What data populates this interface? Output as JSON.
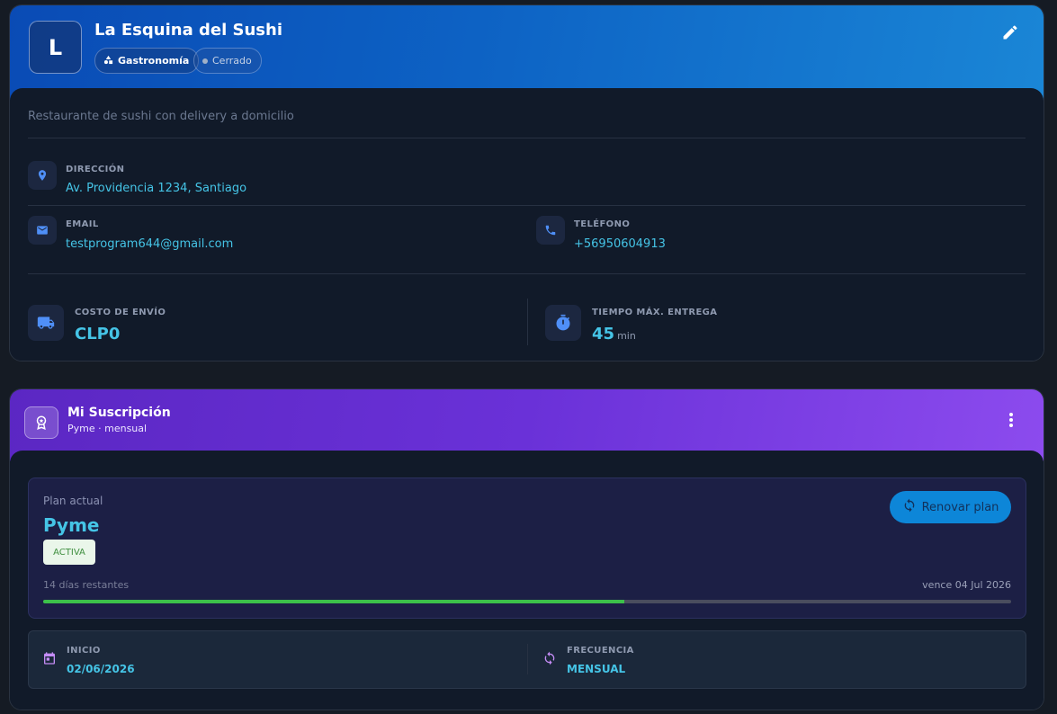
{
  "business": {
    "initial": "L",
    "name": "La Esquina del Sushi",
    "category": "Gastronomía",
    "status": "Cerrado",
    "description": "Restaurante de sushi con delivery a domicilio",
    "address": {
      "label": "DIRECCIÓN",
      "value": "Av. Providencia 1234, Santiago"
    },
    "email": {
      "label": "EMAIL",
      "value": "testprogram644@gmail.com"
    },
    "phone": {
      "label": "TELÉFONO",
      "value": "+56950604913"
    },
    "shipping": {
      "label": "COSTO DE ENVÍO",
      "value": "CLP0"
    },
    "delivery_time": {
      "label": "TIEMPO MÁX. ENTREGA",
      "value": "45",
      "unit": "min"
    }
  },
  "subscription": {
    "title": "Mi Suscripción",
    "subtitle": "Pyme · mensual",
    "plan_label": "Plan actual",
    "plan_name": "Pyme",
    "status_badge": "ACTIVA",
    "renew_label": "Renovar plan",
    "days_remaining": "14 días restantes",
    "expires": "vence 04 Jul 2026",
    "progress_fraction": 0.6,
    "start": {
      "label": "INICIO",
      "value": "02/06/2026"
    },
    "frequency": {
      "label": "FRECUENCIA",
      "value": "MENSUAL"
    }
  },
  "icons": {
    "edit": "pencil-icon",
    "category": "shapes-icon",
    "address": "location-pin-icon",
    "email": "envelope-icon",
    "phone": "phone-icon",
    "shipping": "truck-icon",
    "delivery_time": "timer-icon",
    "subscription": "award-badge-icon",
    "more": "more-vertical-icon",
    "renew": "refresh-icon",
    "start": "calendar-icon",
    "frequency": "sync-icon"
  },
  "colors": {
    "accent": "#45c4e6",
    "header_blue": "#0d62c4",
    "header_purple": "#6a31d8",
    "progress": "#3cc04a",
    "icon_blue": "#4f8ff7"
  }
}
